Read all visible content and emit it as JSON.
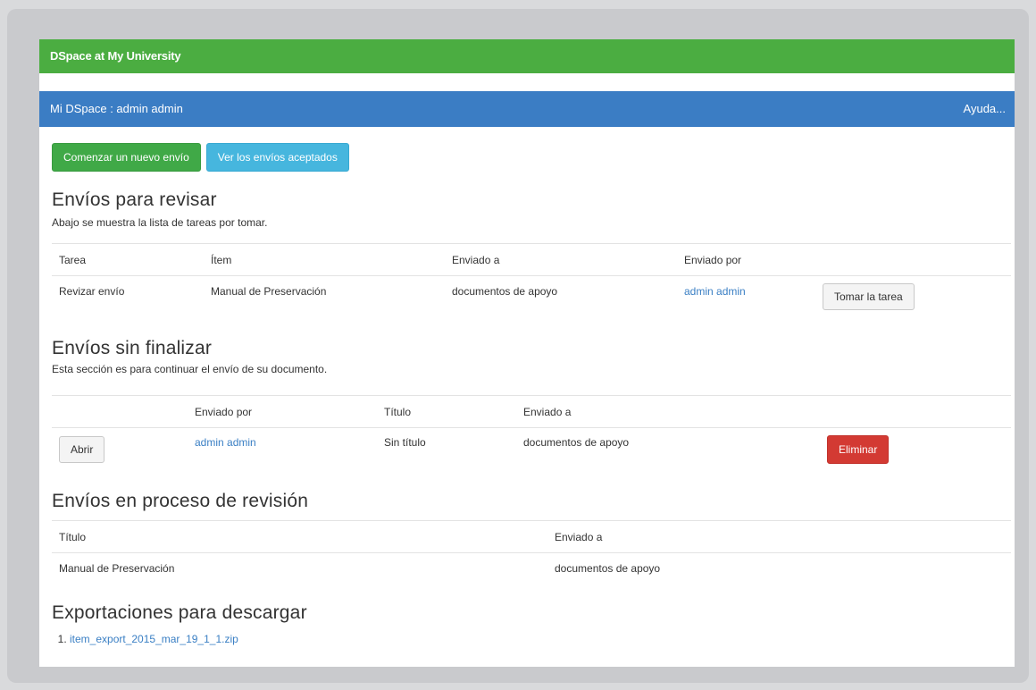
{
  "header": {
    "site_title": "DSpace at My University"
  },
  "navbar": {
    "title": "Mi DSpace : admin admin",
    "help": "Ayuda..."
  },
  "actions": {
    "new_submission": "Comenzar un nuevo envío",
    "accepted_submissions": "Ver los envíos aceptados"
  },
  "review": {
    "heading": "Envíos para revisar",
    "description": "Abajo se muestra la lista de tareas por tomar.",
    "columns": [
      "Tarea",
      "Ítem",
      "Enviado a",
      "Enviado por"
    ],
    "row": {
      "task": "Revizar envío",
      "item": "Manual de Preservación",
      "sent_to": "documentos de apoyo",
      "sent_by": "admin admin",
      "button": "Tomar la tarea"
    }
  },
  "unfinished": {
    "heading": "Envíos sin finalizar",
    "description": "Esta sección es para continuar el envío de su documento.",
    "columns": [
      "Enviado por",
      "Título",
      "Enviado a"
    ],
    "row": {
      "open_button": "Abrir",
      "sent_by": "admin admin",
      "title": "Sin título",
      "sent_to": "documentos de apoyo",
      "delete_button": "Eliminar"
    }
  },
  "in_review": {
    "heading": "Envíos en proceso de revisión",
    "columns": [
      "Título",
      "Enviado a"
    ],
    "row": {
      "title": "Manual de Preservación",
      "sent_to": "documentos de apoyo"
    }
  },
  "exports": {
    "heading": "Exportaciones para descargar",
    "items": [
      "item_export_2015_mar_19_1_1.zip"
    ]
  },
  "colors": {
    "topbar": "#4bad41",
    "navbar": "#3b7dc4",
    "link": "#3a7fc4",
    "danger": "#d33a33",
    "info": "#46b6de",
    "success": "#40a947"
  }
}
